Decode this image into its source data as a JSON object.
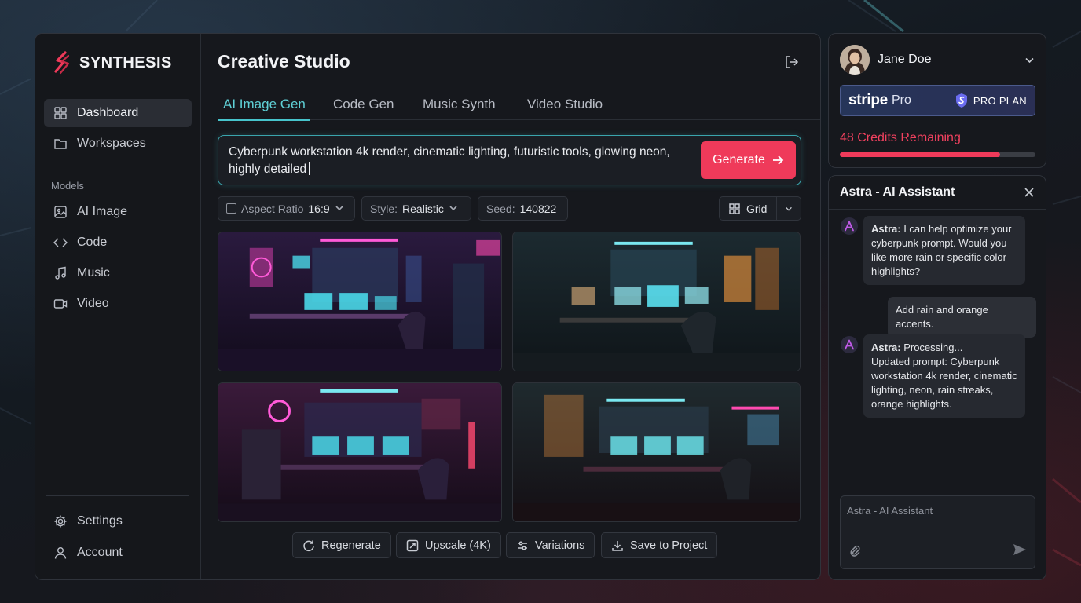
{
  "brand": {
    "name": "SYNTHESIS"
  },
  "sidebar": {
    "primary": [
      {
        "label": "Dashboard",
        "icon": "dashboard-icon",
        "active": true
      },
      {
        "label": "Workspaces",
        "icon": "folder-icon"
      }
    ],
    "section_label": "Models",
    "models": [
      {
        "label": "AI Image",
        "icon": "image-icon"
      },
      {
        "label": "Code",
        "icon": "code-icon"
      },
      {
        "label": "Music",
        "icon": "music-icon"
      },
      {
        "label": "Video",
        "icon": "video-icon"
      }
    ],
    "footer": [
      {
        "label": "Settings",
        "icon": "gear-icon"
      },
      {
        "label": "Account",
        "icon": "user-icon"
      }
    ]
  },
  "header": {
    "title": "Creative Studio"
  },
  "tabs": [
    {
      "label": "AI Image Gen",
      "active": true
    },
    {
      "label": "Code Gen"
    },
    {
      "label": "Music Synth"
    },
    {
      "label": "Video Studio"
    }
  ],
  "prompt": {
    "value": "Cyberpunk workstation 4k render, cinematic lighting, futuristic tools, glowing neon, highly detailed",
    "generate_label": "Generate"
  },
  "options": {
    "aspect_label": "Aspect Ratio",
    "aspect_value": "16:9",
    "style_label": "Style:",
    "style_value": "Realistic",
    "seed_label": "Seed:",
    "seed_value": "140822",
    "view_label": "Grid"
  },
  "actions": [
    {
      "label": "Regenerate",
      "icon": "refresh-icon"
    },
    {
      "label": "Upscale (4K)",
      "icon": "expand-icon"
    },
    {
      "label": "Variations",
      "icon": "sliders-icon"
    },
    {
      "label": "Save to Project",
      "icon": "download-icon"
    }
  ],
  "user": {
    "name": "Jane Doe",
    "plan_brand": "stripe",
    "plan_tier": "Pro",
    "plan_badge": "PRO PLAN",
    "credits_text": "48 Credits Remaining",
    "credits_fraction": 0.82
  },
  "chat": {
    "title": "Astra - AI Assistant",
    "messages": [
      {
        "from": "bot",
        "who": "Astra:",
        "text": "I can help optimize your cyberpunk prompt. Would you like more rain or specific color highlights?"
      },
      {
        "from": "user",
        "text": "Add rain and orange accents."
      },
      {
        "from": "bot",
        "who": "Astra:",
        "text": "Processing...",
        "text2": "Updated prompt: Cyberpunk workstation 4k render, cinematic lighting, neon, rain streaks, orange highlights."
      }
    ],
    "input_placeholder": "Astra - AI Assistant"
  },
  "colors": {
    "accent_teal": "#47c4cc",
    "accent_red": "#ef3a5a",
    "panel_bg": "#16181d"
  }
}
